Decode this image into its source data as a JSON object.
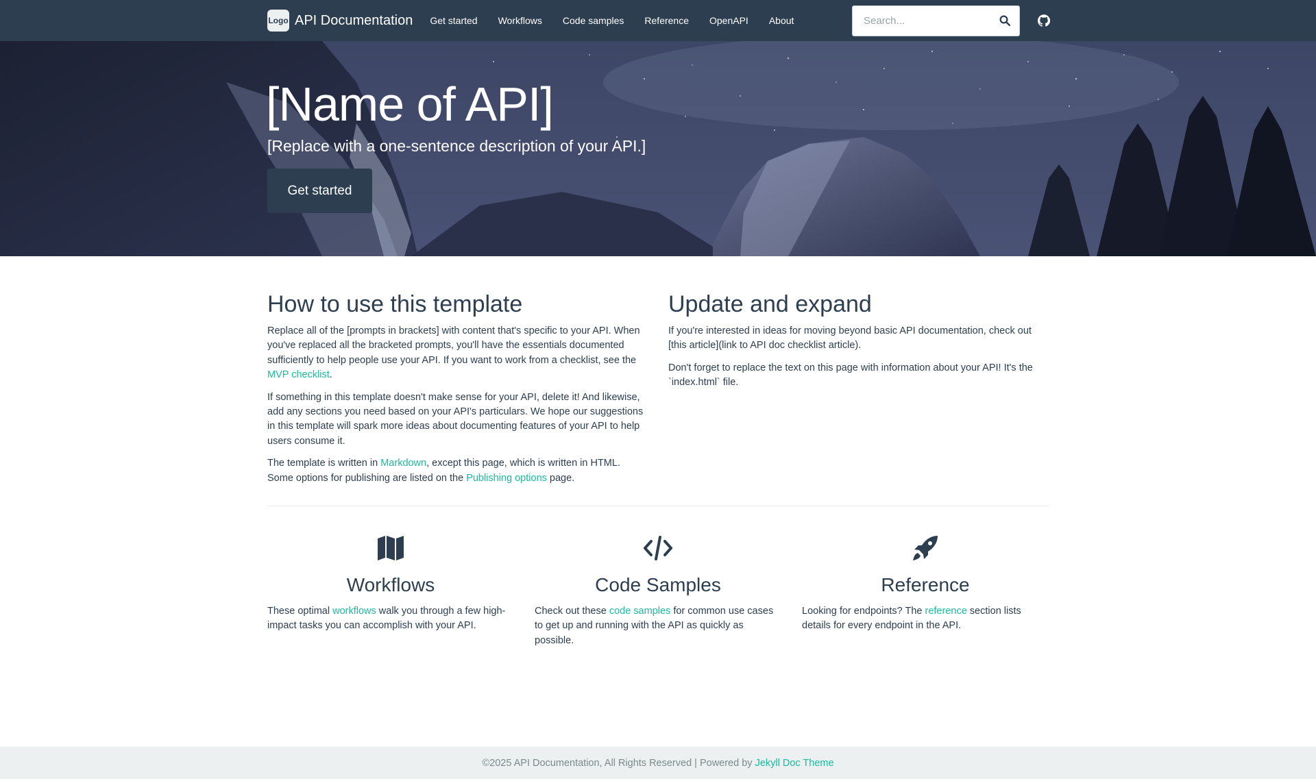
{
  "nav": {
    "logo_text": "Logo",
    "brand": "API Documentation",
    "links": [
      "Get started",
      "Workflows",
      "Code samples",
      "Reference",
      "OpenAPI",
      "About"
    ],
    "search_placeholder": "Search...",
    "search_icon": "search-icon",
    "github_icon": "github-icon"
  },
  "hero": {
    "title": "[Name of API]",
    "subtitle": "[Replace with a one-sentence description of your API.]",
    "cta": "Get started"
  },
  "how_to": {
    "heading": "How to use this template",
    "p1_text": "Replace all of the [prompts in brackets] with content that's specific to your API. When you've replaced all the bracketed prompts, you'll have the essentials documented sufficiently to help people use your API. If you want to work from a checklist, see the ",
    "p1_link": "MVP checklist",
    "p1_end": ".",
    "p2": "If something in this template doesn't make sense for your API, delete it! And likewise, add any sections you need based on your API's particulars. We hope our suggestions in this template will spark more ideas about documenting features of your API to help users consume it.",
    "p3_text": "The template is written in ",
    "p3_link1": "Markdown",
    "p3_mid": ", except this page, which is written in HTML. Some options for publishing are listed on the ",
    "p3_link2": "Publishing options",
    "p3_end": " page."
  },
  "update": {
    "heading": "Update and expand",
    "p1": "If you're interested in ideas for moving beyond basic API documentation, check out [this article](link to API doc checklist article).",
    "p2": "Don't forget to replace the text on this page with information about your API! It's the `index.html` file."
  },
  "features": [
    {
      "icon": "map-icon",
      "title": "Workflows",
      "pre": "These optimal ",
      "link": "workflows",
      "post": " walk you through a few high-impact tasks you can accomplish with your API."
    },
    {
      "icon": "code-icon",
      "title": "Code Samples",
      "pre": "Check out these ",
      "link": "code samples",
      "post": " for common use cases to get up and running with the API as quickly as possible."
    },
    {
      "icon": "rocket-icon",
      "title": "Reference",
      "pre": "Looking for endpoints? The ",
      "link": "reference",
      "post": " section lists details for every endpoint in the API."
    }
  ],
  "footer": {
    "text": "©2025 API Documentation, All Rights Reserved | Powered by ",
    "link": "Jekyll Doc Theme"
  },
  "colors": {
    "navbar": "#2c3e50",
    "accent_link": "#18bc9c",
    "footer_bg": "#ecf0f1"
  }
}
